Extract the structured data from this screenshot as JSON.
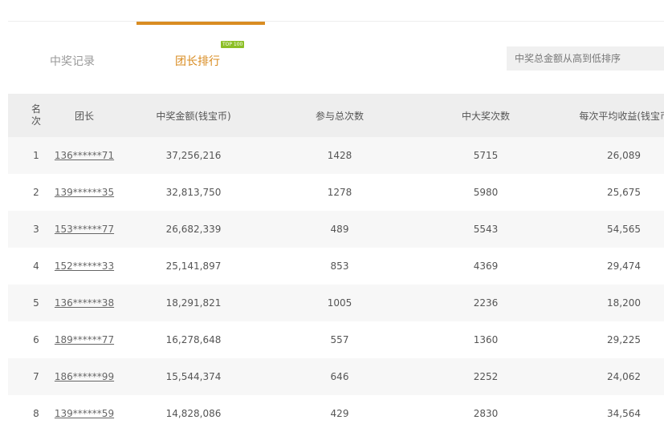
{
  "tabs": [
    {
      "label": "中奖记录",
      "active": false
    },
    {
      "label": "团长排行",
      "active": true,
      "badge": "TOP 100"
    }
  ],
  "sort": {
    "label": "中奖总金额从高到低排序"
  },
  "table": {
    "headers": {
      "rank_line1": "名",
      "rank_line2": "次",
      "leader": "团长",
      "amount": "中奖金额(钱宝币)",
      "total": "参与总次数",
      "big": "中大奖次数",
      "avg": "每次平均收益(钱宝币)"
    },
    "rows": [
      {
        "rank": "1",
        "leader": "136******71",
        "amount": "37,256,216",
        "total": "1428",
        "big": "5715",
        "avg": "26,089"
      },
      {
        "rank": "2",
        "leader": "139******35",
        "amount": "32,813,750",
        "total": "1278",
        "big": "5980",
        "avg": "25,675"
      },
      {
        "rank": "3",
        "leader": "153******77",
        "amount": "26,682,339",
        "total": "489",
        "big": "5543",
        "avg": "54,565"
      },
      {
        "rank": "4",
        "leader": "152******33",
        "amount": "25,141,897",
        "total": "853",
        "big": "4369",
        "avg": "29,474"
      },
      {
        "rank": "5",
        "leader": "136******38",
        "amount": "18,291,821",
        "total": "1005",
        "big": "2236",
        "avg": "18,200"
      },
      {
        "rank": "6",
        "leader": "189******77",
        "amount": "16,278,648",
        "total": "557",
        "big": "1360",
        "avg": "29,225"
      },
      {
        "rank": "7",
        "leader": "186******99",
        "amount": "15,544,374",
        "total": "646",
        "big": "2252",
        "avg": "24,062"
      },
      {
        "rank": "8",
        "leader": "139******59",
        "amount": "14,828,086",
        "total": "429",
        "big": "2830",
        "avg": "34,564"
      }
    ]
  },
  "colors": {
    "accent": "#d98c22",
    "badge": "#8cbf26",
    "header_bg": "#eeeeee",
    "stripe": "#f7f7f7"
  }
}
